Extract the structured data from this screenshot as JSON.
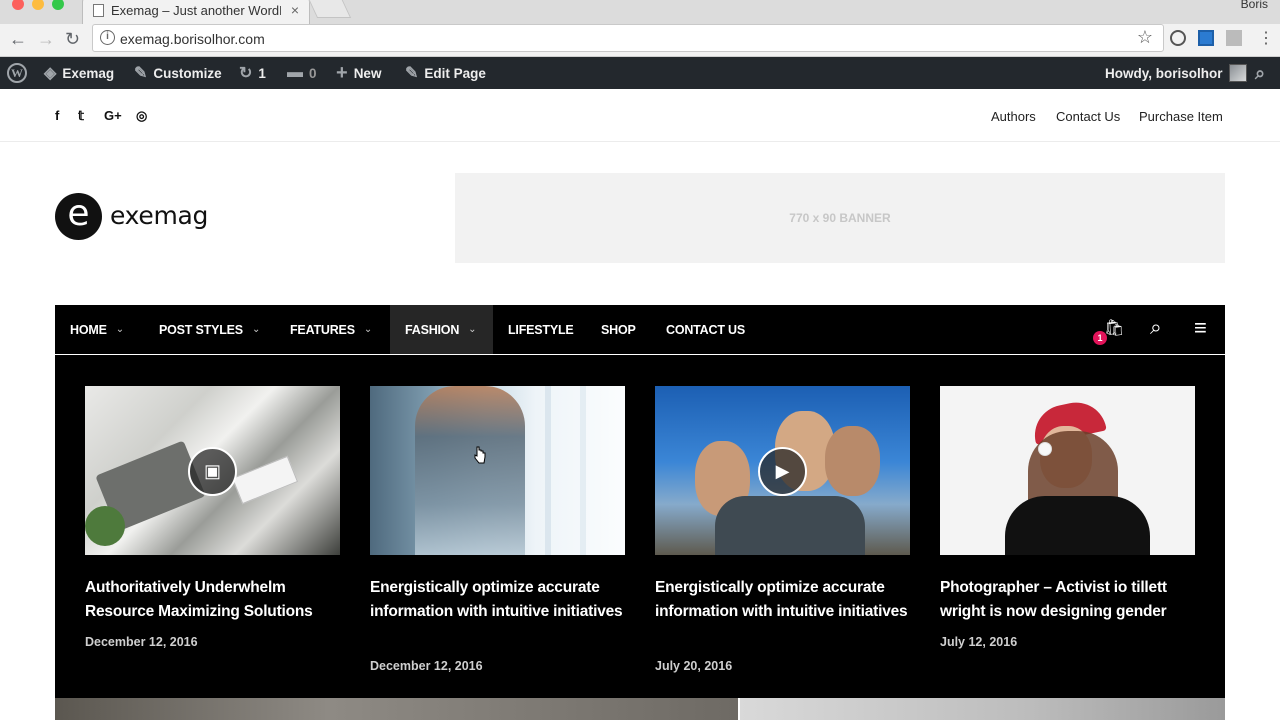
{
  "browser": {
    "tab_title": "Exemag – Just another WordPr",
    "tab_close": "×",
    "profile_name": "Boris",
    "url": "exemag.borisolhor.com",
    "back": "←",
    "forward": "→",
    "reload": "↻",
    "info": "i",
    "star": "☆"
  },
  "adminbar": {
    "site_name": "Exemag",
    "customize": "Customize",
    "updates_count": "1",
    "comments_count": "0",
    "new_label": "New",
    "edit_page": "Edit Page",
    "howdy": "Howdy, borisolhor",
    "wp_logo": "W",
    "icons": {
      "site": "◈",
      "customize": "✎",
      "updates": "↻",
      "comments": "▬",
      "new": "+",
      "edit": "✎",
      "search": "⌕"
    }
  },
  "topbar": {
    "social": [
      "f",
      "𝕥",
      "G+",
      "◎"
    ],
    "links": [
      "Authors",
      "Contact Us",
      "Purchase Item"
    ]
  },
  "header": {
    "logo_mark": "e",
    "logo_text": "exemag",
    "banner_text": "770 x 90 BANNER"
  },
  "menu": {
    "items": [
      {
        "label": "HOME",
        "caret": "⌄"
      },
      {
        "label": "POST STYLES",
        "caret": "⌄"
      },
      {
        "label": "FEATURES",
        "caret": "⌄"
      },
      {
        "label": "FASHION",
        "caret": "⌄"
      },
      {
        "label": "LIFESTYLE"
      },
      {
        "label": "SHOP"
      },
      {
        "label": "CONTACT US"
      }
    ],
    "cart_count": "1",
    "icons": {
      "cart": "🛍",
      "search": "⌕",
      "hamburger": "≡"
    }
  },
  "mega": {
    "posts": [
      {
        "title": "Authoritatively Underwhelm Resource Maximizing Solutions",
        "date": "December 12, 2016",
        "badge": "▣"
      },
      {
        "title": "Energistically optimize accurate information with intuitive initiatives",
        "date": "December 12, 2016"
      },
      {
        "title": "Energistically optimize accurate information with intuitive initiatives",
        "date": "July 20, 2016",
        "badge": "▶"
      },
      {
        "title": "Photographer – Activist io tillett wright is now designing gender",
        "date": "July 12, 2016"
      }
    ]
  }
}
